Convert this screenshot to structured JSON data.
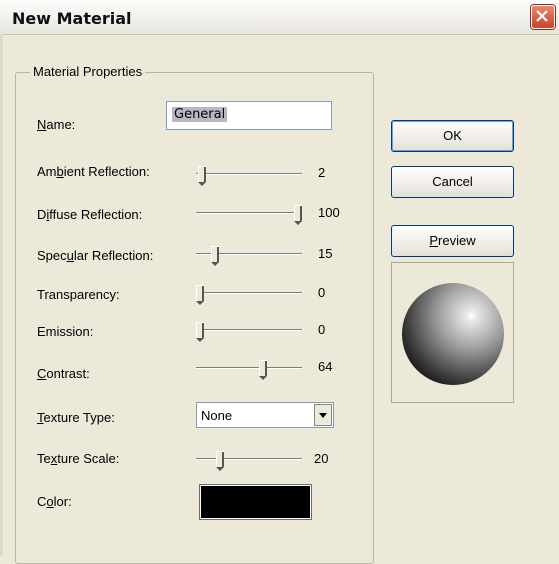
{
  "window": {
    "title": "New Material"
  },
  "group": {
    "label": "Material Properties"
  },
  "name": {
    "label": "Name:",
    "value": "General"
  },
  "sliders": [
    {
      "label": "Ambient Reflection:",
      "value": "2",
      "level": 0.02
    },
    {
      "label": "Diffuse Reflection:",
      "value": "100",
      "level": 1.0
    },
    {
      "label": "Specular Reflection:",
      "value": "15",
      "level": 0.15
    },
    {
      "label": "Transparency:",
      "value": "0",
      "level": 0.0
    },
    {
      "label": "Emission:",
      "value": "0",
      "level": 0.0
    },
    {
      "label": "Contrast:",
      "value": "64",
      "level": 0.64
    }
  ],
  "texture_type": {
    "label": "Texture Type:",
    "value": "None"
  },
  "texture_scale": {
    "label": "Texture Scale:",
    "value": "20",
    "level": 0.2
  },
  "color": {
    "label": "Color:",
    "swatch": "#000000"
  },
  "buttons": {
    "ok": "OK",
    "cancel": "Cancel",
    "preview": "Preview"
  },
  "icons": {
    "close": "close-icon",
    "dropdown": "chevron-down-icon",
    "sphere": "sphere-preview"
  }
}
